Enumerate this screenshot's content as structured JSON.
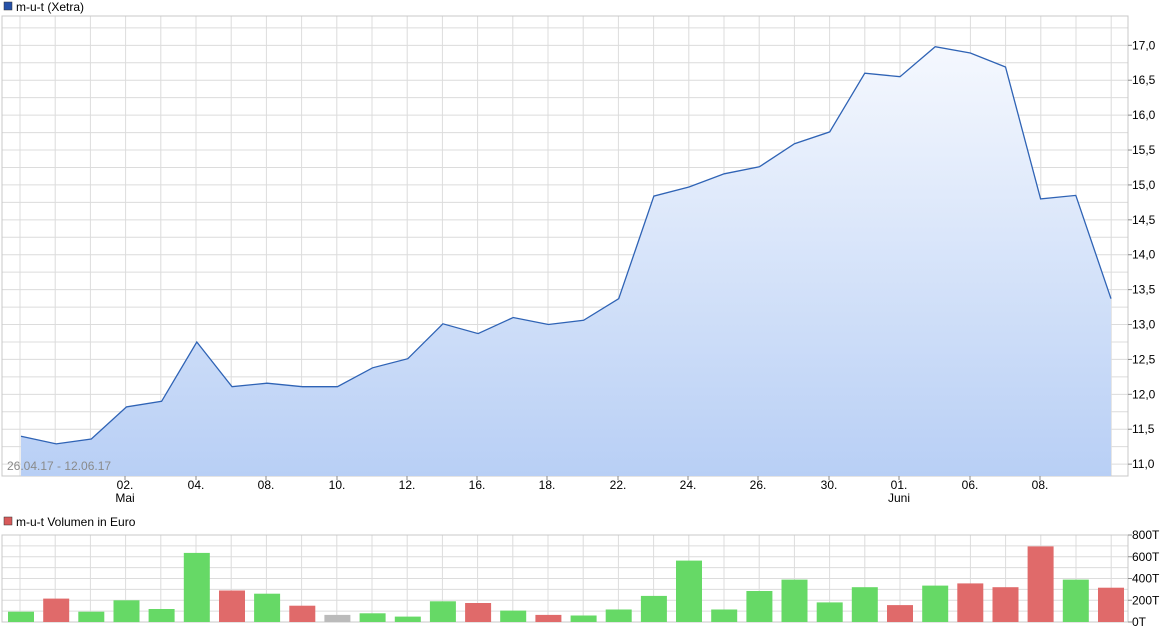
{
  "colors": {
    "price_line": "#2f63b5",
    "area_top": "#f5f8fe",
    "area_bottom": "#b8cff5",
    "grid": "#dcdcdc",
    "frame": "#c8c8c8",
    "text": "#000000",
    "range_text": "#8a8a8a",
    "vol_up": "#66d966",
    "vol_down": "#e06a6a",
    "vol_neutral": "#bbbbbb",
    "legend_price": "#2752a8",
    "legend_volume": "#d85a5a"
  },
  "chart_data": [
    {
      "type": "area",
      "title": "m-u-t (Xetra)",
      "date_range_label": "26.04.17 - 12.06.17",
      "x_tick_labels": [
        {
          "day": "02.",
          "month": "Mai"
        },
        {
          "day": "04.",
          "month": ""
        },
        {
          "day": "08.",
          "month": ""
        },
        {
          "day": "10.",
          "month": ""
        },
        {
          "day": "12.",
          "month": ""
        },
        {
          "day": "16.",
          "month": ""
        },
        {
          "day": "18.",
          "month": ""
        },
        {
          "day": "22.",
          "month": ""
        },
        {
          "day": "24.",
          "month": ""
        },
        {
          "day": "26.",
          "month": ""
        },
        {
          "day": "30.",
          "month": ""
        },
        {
          "day": "01.",
          "month": "Juni"
        },
        {
          "day": "06.",
          "month": ""
        },
        {
          "day": "08.",
          "month": ""
        }
      ],
      "y_ticks": [
        "11,0",
        "11,5",
        "12,0",
        "12,5",
        "13,0",
        "13,5",
        "14,0",
        "14,5",
        "15,0",
        "15,5",
        "16,0",
        "16,5",
        "17,0"
      ],
      "ylim": [
        10.83,
        17.42
      ],
      "grid": true,
      "series": [
        {
          "values": [
            11.4,
            11.29,
            11.36,
            11.82,
            11.9,
            12.75,
            12.11,
            12.16,
            12.11,
            12.11,
            12.38,
            12.51,
            13.01,
            12.87,
            13.1,
            13.0,
            13.06,
            13.37,
            14.84,
            14.97,
            15.16,
            15.26,
            15.59,
            15.76,
            16.6,
            16.55,
            16.98,
            16.89,
            16.69,
            14.8,
            14.85,
            13.37
          ]
        }
      ]
    },
    {
      "type": "bar",
      "title": "m-u-t Volumen in Euro",
      "y_ticks": [
        "0T",
        "200T",
        "400T",
        "600T",
        "800T"
      ],
      "ylim": [
        0,
        800
      ],
      "grid": true,
      "series": [
        {
          "values": [
            95,
            215,
            95,
            200,
            120,
            635,
            290,
            260,
            150,
            65,
            80,
            50,
            190,
            175,
            105,
            65,
            60,
            115,
            240,
            565,
            115,
            285,
            390,
            180,
            320,
            155,
            335,
            355,
            320,
            695,
            390,
            315
          ],
          "directions": [
            "up",
            "down",
            "up",
            "up",
            "up",
            "up",
            "down",
            "up",
            "down",
            "flat",
            "up",
            "up",
            "up",
            "down",
            "up",
            "down",
            "up",
            "up",
            "up",
            "up",
            "up",
            "up",
            "up",
            "up",
            "up",
            "down",
            "up",
            "down",
            "down",
            "down",
            "up",
            "down"
          ]
        }
      ]
    }
  ]
}
